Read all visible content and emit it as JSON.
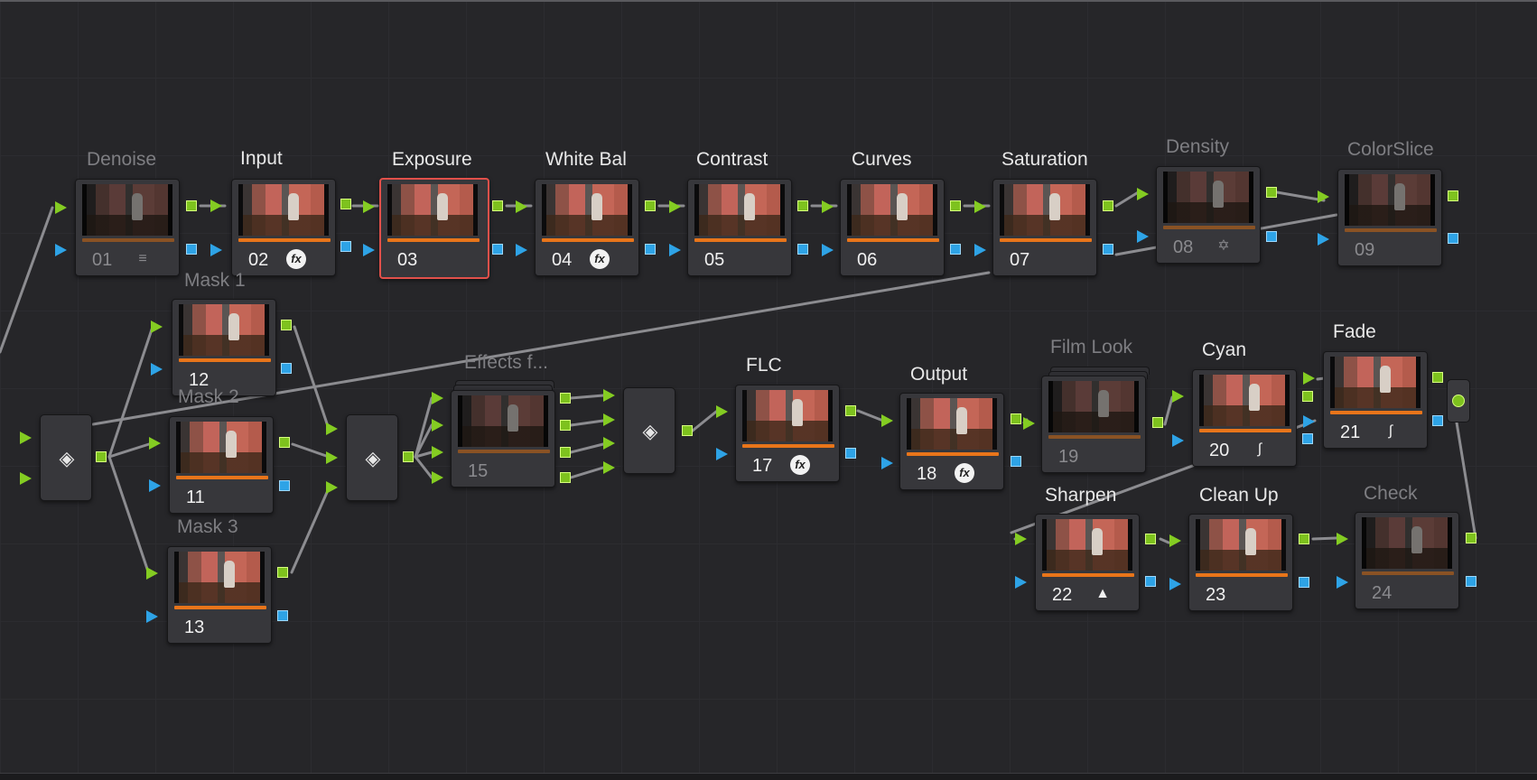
{
  "nodes": [
    {
      "id": "n01",
      "number": "01",
      "label": "Denoise",
      "disabled": true,
      "badge": "denoise-icon",
      "badge_glyph": "≡"
    },
    {
      "id": "n02",
      "number": "02",
      "label": "Input",
      "disabled": false,
      "badge": "fx-icon",
      "badge_glyph": "fx"
    },
    {
      "id": "n03",
      "number": "03",
      "label": "Exposure",
      "disabled": false,
      "selected": true
    },
    {
      "id": "n04",
      "number": "04",
      "label": "White Bal",
      "disabled": false,
      "badge": "fx-icon",
      "badge_glyph": "fx"
    },
    {
      "id": "n05",
      "number": "05",
      "label": "Contrast",
      "disabled": false
    },
    {
      "id": "n06",
      "number": "06",
      "label": "Curves",
      "disabled": false
    },
    {
      "id": "n07",
      "number": "07",
      "label": "Saturation",
      "disabled": false
    },
    {
      "id": "n08",
      "number": "08",
      "label": "Density",
      "disabled": true,
      "badge": "density-icon",
      "badge_glyph": "✡"
    },
    {
      "id": "n09",
      "number": "09",
      "label": "ColorSlice",
      "disabled": true
    },
    {
      "id": "n12",
      "number": "12",
      "label": "Mask 1",
      "disabled": false
    },
    {
      "id": "n11",
      "number": "11",
      "label": "Mask 2",
      "disabled": false
    },
    {
      "id": "n13",
      "number": "13",
      "label": "Mask 3",
      "disabled": false
    },
    {
      "id": "n15",
      "number": "15",
      "label": "Effects f...",
      "disabled": true
    },
    {
      "id": "n17",
      "number": "17",
      "label": "FLC",
      "disabled": false,
      "badge": "fx-icon",
      "badge_glyph": "fx"
    },
    {
      "id": "n18",
      "number": "18",
      "label": "Output",
      "disabled": false,
      "badge": "fx-icon",
      "badge_glyph": "fx"
    },
    {
      "id": "n19",
      "number": "19",
      "label": "Film Look",
      "disabled": true
    },
    {
      "id": "n20",
      "number": "20",
      "label": "Cyan",
      "disabled": false,
      "badge": "curve-icon",
      "badge_glyph": "∫"
    },
    {
      "id": "n21",
      "number": "21",
      "label": "Fade",
      "disabled": false,
      "badge": "curve-icon",
      "badge_glyph": "∫"
    },
    {
      "id": "n22",
      "number": "22",
      "label": "Sharpen",
      "disabled": false,
      "badge": "sharpen-icon",
      "badge_glyph": "▲"
    },
    {
      "id": "n23",
      "number": "23",
      "label": "Clean Up",
      "disabled": false
    },
    {
      "id": "n24",
      "number": "24",
      "label": "Check",
      "disabled": true
    }
  ],
  "mixers": [
    {
      "id": "mix1",
      "icon": "layer-mixer-icon"
    },
    {
      "id": "mix2",
      "icon": "layer-mixer-icon"
    },
    {
      "id": "mix3",
      "icon": "layer-mixer-icon"
    }
  ],
  "output": {
    "icon": "output-node-icon"
  },
  "colors": {
    "rgb_port": "#7ec21e",
    "key_port": "#2ea3e6",
    "selection": "#e2504a",
    "bar": "#e8751a",
    "wire": "#8a8a8e"
  }
}
